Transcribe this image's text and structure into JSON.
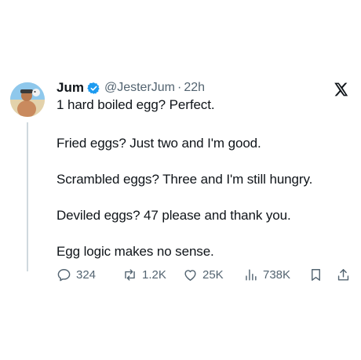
{
  "tweet": {
    "author": {
      "name": "Jum",
      "handle": "@JesterJum",
      "separator": "·",
      "time": "22h",
      "verified": true,
      "badge_color": "#1d9bf0"
    },
    "lines": [
      "1 hard boiled egg? Perfect.",
      "Fried eggs? Just two and I'm good.",
      "Scrambled eggs? Three and I'm still hungry.",
      "Deviled eggs? 47 please and thank you.",
      "Egg logic makes no sense."
    ],
    "actions": {
      "replies": "324",
      "reposts": "1.2K",
      "likes": "25K",
      "views": "738K",
      "icons": [
        "reply-icon",
        "repost-icon",
        "like-icon",
        "views-icon",
        "bookmark-icon",
        "share-icon"
      ]
    },
    "colors": {
      "text": "#0f1419",
      "secondary": "#536471",
      "thread_line": "#cfd9de"
    }
  }
}
